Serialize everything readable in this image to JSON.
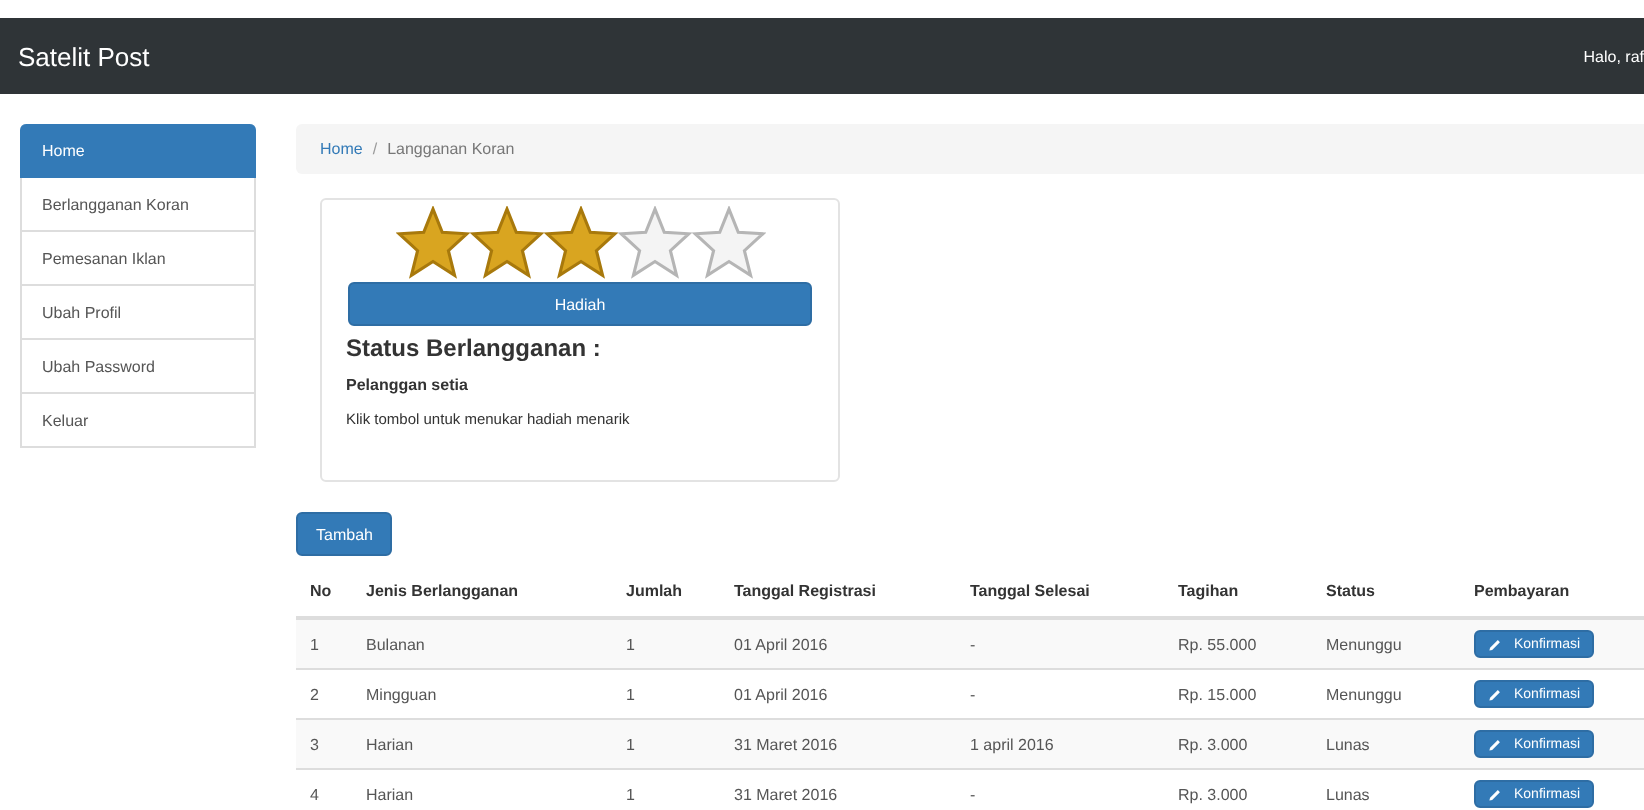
{
  "navbar": {
    "brand": "Satelit Post",
    "greeting": "Halo, raf"
  },
  "sidebar": {
    "items": [
      {
        "label": "Home",
        "selected": true
      },
      {
        "label": "Berlangganan Koran",
        "selected": false
      },
      {
        "label": "Pemesanan Iklan",
        "selected": false
      },
      {
        "label": "Ubah Profil",
        "selected": false
      },
      {
        "label": "Ubah Password",
        "selected": false
      },
      {
        "label": "Keluar",
        "selected": false
      }
    ]
  },
  "breadcrumb": {
    "separator": "/",
    "items": [
      "Home",
      "Langganan Koran"
    ]
  },
  "status_card": {
    "stars": 3,
    "button": "Hadiah",
    "title": "Status Berlangganan :",
    "status": "Pelanggan setia",
    "hint": "Klik tombol untuk menukar hadiah menarik"
  },
  "add_button": "Tambah",
  "table": {
    "columns": [
      "No",
      "Jenis Berlangganan",
      "Jumlah",
      "Tanggal Registrasi",
      "Tanggal Selesai",
      "Tagihan",
      "Status",
      "Pembayaran"
    ],
    "rows": [
      {
        "cells": [
          "1",
          "Bulanan",
          "1",
          "01 April 2016",
          "-",
          "Rp. 55.000",
          "Menunggu"
        ],
        "action": "Konfirmasi"
      },
      {
        "cells": [
          "2",
          "Mingguan",
          "1",
          "01 April 2016",
          "-",
          "Rp. 15.000",
          "Menunggu"
        ],
        "action": "Konfirmasi"
      },
      {
        "cells": [
          "3",
          "Harian",
          "1",
          "31 Maret 2016",
          "1 april 2016",
          "Rp. 3.000",
          "Lunas"
        ],
        "action": "Konfirmasi"
      },
      {
        "cells": [
          "4",
          "Harian",
          "1",
          "31 Maret 2016",
          "-",
          "Rp. 3.000",
          "Lunas"
        ],
        "action": "Konfirmasi"
      }
    ]
  }
}
